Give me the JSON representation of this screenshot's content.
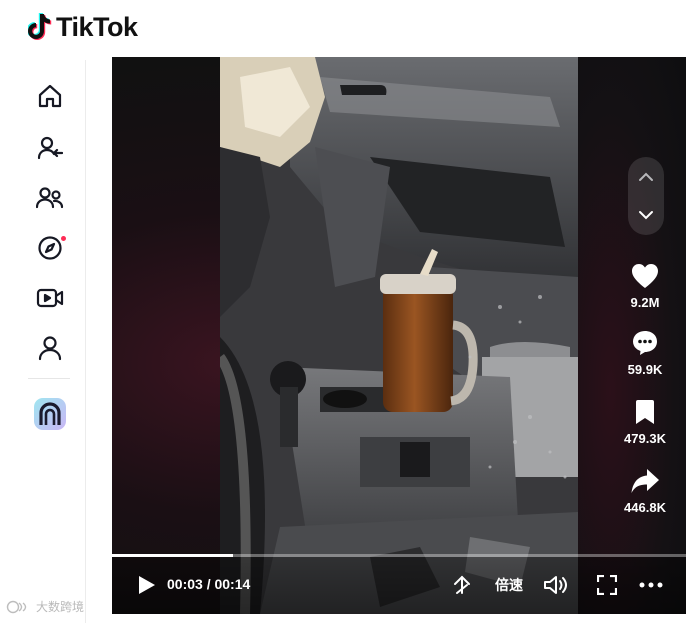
{
  "brand": {
    "name": "TikTok"
  },
  "sidebar": {
    "items": [
      {
        "icon": "home-icon"
      },
      {
        "icon": "following-icon"
      },
      {
        "icon": "friends-icon"
      },
      {
        "icon": "explore-icon",
        "notification_dot": true
      },
      {
        "icon": "live-icon"
      },
      {
        "icon": "profile-icon"
      },
      {
        "icon": "mini-app-icon"
      }
    ]
  },
  "video": {
    "progress_fraction": 0.21,
    "current_time": "00:03",
    "duration": "00:14",
    "time_display": "00:03 / 00:14",
    "speed_label": "倍速"
  },
  "actions": {
    "likes": "9.2M",
    "comments": "59.9K",
    "saves": "479.3K",
    "shares": "446.8K"
  },
  "watermark": {
    "text": "大数跨境"
  },
  "colors": {
    "accent": "#fe2c55",
    "cyan": "#25f4ee",
    "tumbler": "#8a4a1e"
  }
}
